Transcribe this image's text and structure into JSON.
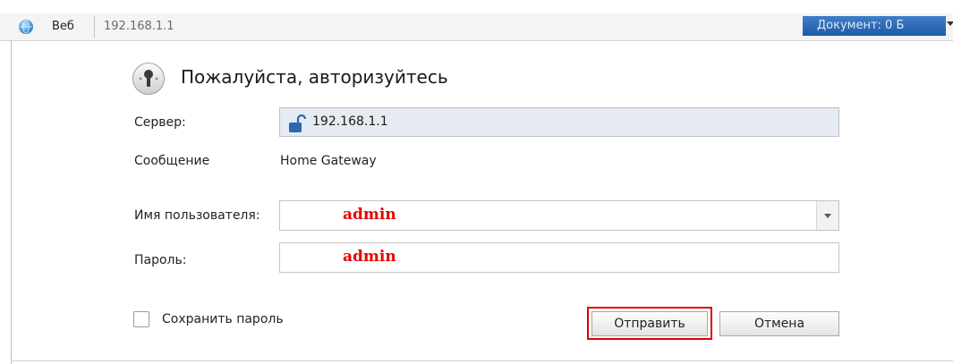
{
  "topbar": {
    "tab_label": "Веб",
    "url": "192.168.1.1",
    "document_info": "Документ:  0 Б"
  },
  "dialog": {
    "title": "Пожалуйста, авторизуйтесь",
    "server_label": "Сервер:",
    "server_value": "192.168.1.1",
    "message_label": "Сообщение",
    "message_value": "Home Gateway",
    "username_label": "Имя пользователя:",
    "username_value": "admin",
    "password_label": "Пароль:",
    "password_value": "admin",
    "save_password_label": "Сохранить пароль",
    "submit_label": "Отправить",
    "cancel_label": "Отмена"
  },
  "icons": {
    "globe": "globe-icon",
    "key": "key-icon",
    "lock": "unlocked-padlock-icon",
    "dropdown": "chevron-down-icon"
  },
  "colors": {
    "highlight": "#e00000",
    "input_text": "#e60000",
    "doc_bar": "#2a67b5"
  }
}
